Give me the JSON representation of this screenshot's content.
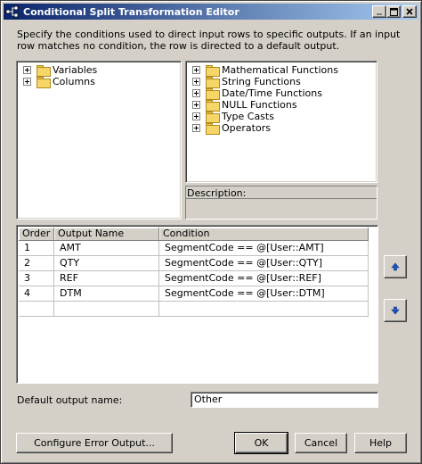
{
  "window": {
    "title": "Conditional Split Transformation Editor"
  },
  "description": "Specify the conditions used to direct input rows to specific outputs. If an input row matches no condition, the row is directed to a default output.",
  "left_tree": {
    "items": [
      {
        "label": "Variables"
      },
      {
        "label": "Columns"
      }
    ]
  },
  "right_tree": {
    "items": [
      {
        "label": "Mathematical Functions"
      },
      {
        "label": "String Functions"
      },
      {
        "label": "Date/Time Functions"
      },
      {
        "label": "NULL Functions"
      },
      {
        "label": "Type Casts"
      },
      {
        "label": "Operators"
      }
    ]
  },
  "description_panel": {
    "label": "Description:"
  },
  "conditions_grid": {
    "columns": [
      "Order",
      "Output Name",
      "Condition"
    ],
    "rows": [
      {
        "order": "1",
        "output_name": "AMT",
        "condition": "SegmentCode == @[User::AMT]"
      },
      {
        "order": "2",
        "output_name": "QTY",
        "condition": "SegmentCode == @[User::QTY]"
      },
      {
        "order": "3",
        "output_name": "REF",
        "condition": "SegmentCode == @[User::REF]"
      },
      {
        "order": "4",
        "output_name": "DTM",
        "condition": "SegmentCode == @[User::DTM]"
      }
    ]
  },
  "default_output": {
    "label": "Default output name:",
    "value": "Other"
  },
  "buttons": {
    "configure_error": "Configure Error Output...",
    "ok": "OK",
    "cancel": "Cancel",
    "help": "Help"
  },
  "colors": {
    "title_gradient_start": "#0a246a",
    "title_gradient_end": "#a6caf0",
    "face": "#d4d0c8",
    "arrow_blue": "#1f55c8"
  }
}
